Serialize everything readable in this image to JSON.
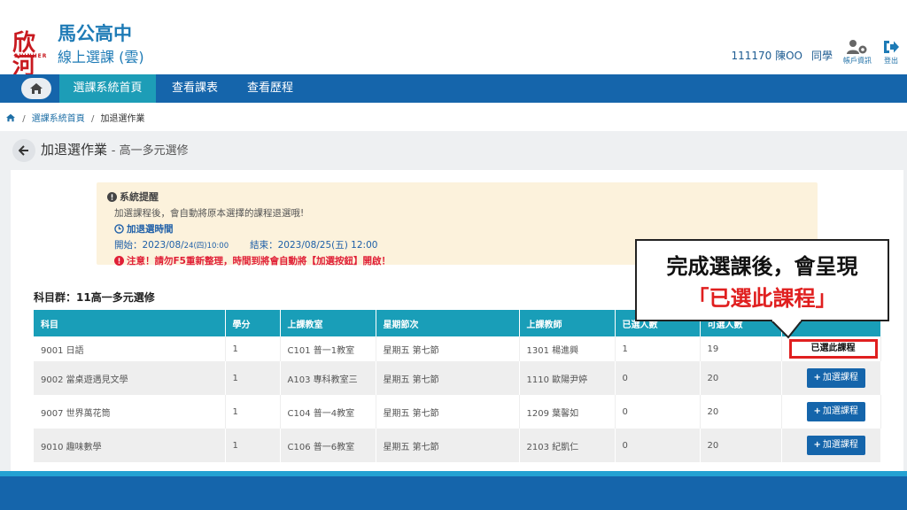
{
  "header": {
    "logo_text": "欣河",
    "logo_sub": "SHINHER",
    "school_name": "馬公高中",
    "system_name": "線上選課 (雲)",
    "user_id_name": "111170 陳OO",
    "user_role": "同學",
    "account_label": "帳戶資訊",
    "logout_label": "登出"
  },
  "nav": {
    "items": [
      {
        "label": "選課系統首頁",
        "active": true
      },
      {
        "label": "查看課表"
      },
      {
        "label": "查看歷程"
      }
    ]
  },
  "breadcrumb": {
    "items": [
      "選課系統首頁",
      "加退選作業"
    ]
  },
  "page": {
    "title": "加退選作業",
    "subtitle": "- 高一多元選修"
  },
  "notice": {
    "title": "系統提醒",
    "line1": "加選課程後，會自動將原本選擇的課程退選哦!",
    "time_heading": "加退選時間",
    "start_label": "開始：2023/08/",
    "start_small": "24(四)10:00",
    "end_label": "結束：2023/08/25(五) 12:00",
    "warning": "注意！請勿F5重新整理，時間到將會自動將【加選按鈕】開啟！"
  },
  "group_label": "科目群：11高一多元選修",
  "table": {
    "headers": [
      "科目",
      "學分",
      "上課教室",
      "星期節次",
      "上課教師",
      "已選人數",
      "可選人數",
      ""
    ],
    "rows": [
      {
        "subject": "9001 日語",
        "credit": "1",
        "room": "C101 普一1教室",
        "period": "星期五 第七節",
        "teacher": "1301 楊進興",
        "selected": "1",
        "capacity": "19",
        "action": "已選此課程",
        "state": "selected"
      },
      {
        "subject": "9002 當桌遊遇見文學",
        "credit": "1",
        "room": "A103 專科教室三",
        "period": "星期五 第七節",
        "teacher": "1110 歐陽尹婷",
        "selected": "0",
        "capacity": "20",
        "action": "加選課程",
        "state": "add"
      },
      {
        "subject": "9007 世界萬花筒",
        "credit": "1",
        "room": "C104 普一4教室",
        "period": "星期五 第七節",
        "teacher": "1209 葉馨如",
        "selected": "0",
        "capacity": "20",
        "action": "加選課程",
        "state": "add"
      },
      {
        "subject": "9010 趣味數學",
        "credit": "1",
        "room": "C106 普一6教室",
        "period": "星期五 第七節",
        "teacher": "2103 紀凱仁",
        "selected": "0",
        "capacity": "20",
        "action": "加選課程",
        "state": "add"
      }
    ]
  },
  "callout": {
    "line1": "完成選課後，會呈現",
    "line2": "「已選此課程」"
  },
  "colors": {
    "primary": "#1565ab",
    "teal": "#199eb8",
    "warning": "#e01f36",
    "notice_bg": "#fcf2dc"
  }
}
